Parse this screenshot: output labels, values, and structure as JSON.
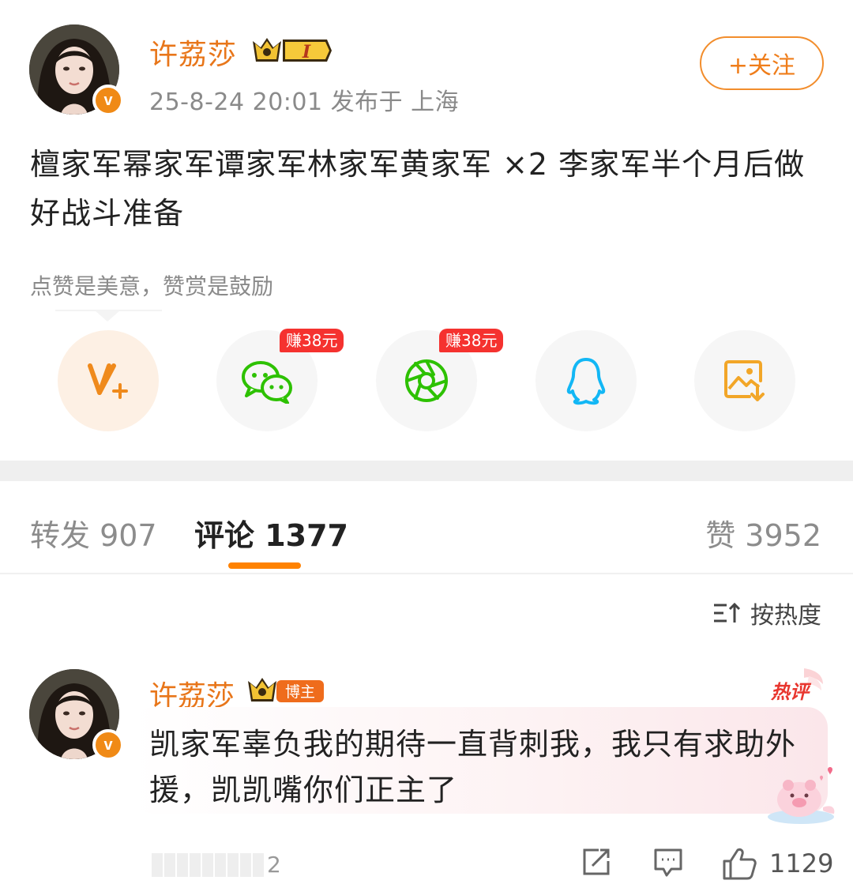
{
  "post": {
    "username": "许荔莎",
    "level": "I",
    "verified": "v",
    "meta": "25-8-24 20:01  发布于 上海",
    "follow_label": "+关注",
    "text": "檀家军幂家军谭家军林家军黄家军 ×2 李家军半个月后做好战斗准备",
    "tip": "点赞是美意，赞赏是鼓励"
  },
  "share": {
    "items": [
      {
        "icon": "vip-plus-icon",
        "badge": ""
      },
      {
        "icon": "wechat-icon",
        "badge": "赚38元"
      },
      {
        "icon": "moments-icon",
        "badge": "赚38元"
      },
      {
        "icon": "qq-icon",
        "badge": ""
      },
      {
        "icon": "save-image-icon",
        "badge": ""
      }
    ]
  },
  "tabs": {
    "repost": "转发 907",
    "comments": "评论 1377",
    "likes": "赞 3952"
  },
  "sort": {
    "label": "按热度"
  },
  "comment": {
    "username": "许荔莎",
    "role_badge": "博主",
    "hot_badge": "热评",
    "verified": "v",
    "text": "凯家军辜负我的期待一直背刺我，我只有求助外援，凯凯嘴你们正主了",
    "id_suffix": "2",
    "like_count": "1129"
  },
  "colors": {
    "accent": "#ff8200",
    "username": "#e8761a",
    "earn_badge": "#f5322f",
    "wechat": "#2dc100",
    "qq": "#12b7f5"
  }
}
